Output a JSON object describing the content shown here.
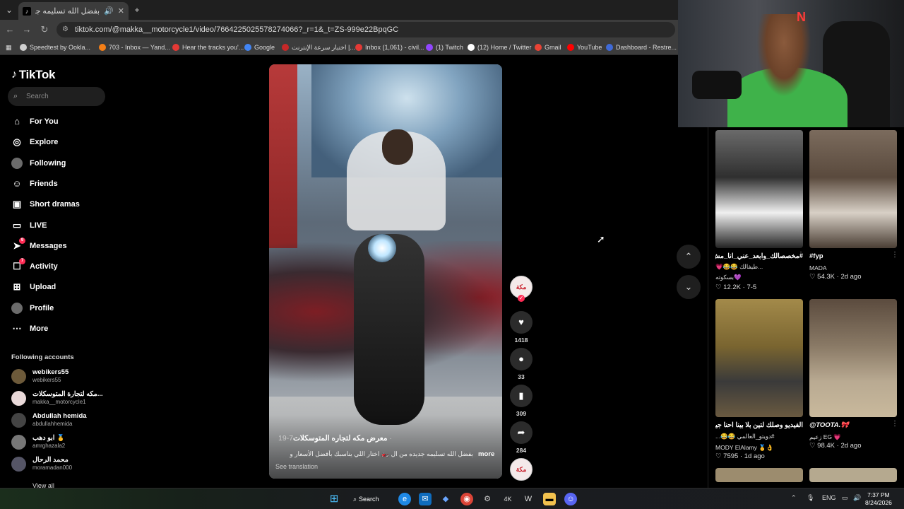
{
  "browser": {
    "tab_title": "بفضل الله تسليمه جديده من",
    "tab_close": "✕",
    "new_tab": "+",
    "url": "tiktok.com/@makka__motorcycle1/video/7664225025578274066?_r=1&_t=ZS-999e22BpqGC",
    "bookmarks": [
      {
        "label": "Speedtest by Ookla...",
        "color": "#cfcfcf"
      },
      {
        "label": "703 - Inbox — Yand...",
        "color": "#f57f17"
      },
      {
        "label": "Hear the tracks you'...",
        "color": "#e53935"
      },
      {
        "label": "Google",
        "color": "#4285f4"
      },
      {
        "label": "اختبار سرعة الإنترنت |...",
        "color": "#c62828"
      },
      {
        "label": "Inbox (1,061) - civil...",
        "color": "#e53935"
      },
      {
        "label": "(1) Twitch",
        "color": "#9146ff"
      },
      {
        "label": "(12) Home / Twitter",
        "color": "#ffffff"
      },
      {
        "label": "Gmail",
        "color": "#ea4335"
      },
      {
        "label": "YouTube",
        "color": "#ff0000"
      },
      {
        "label": "Dashboard - Restre...",
        "color": "#3f6ad8"
      }
    ]
  },
  "sidebar": {
    "logo": "TikTok",
    "search_placeholder": "Search",
    "nav": [
      {
        "label": "For You",
        "icon": "home-icon",
        "glyph": "⌂"
      },
      {
        "label": "Explore",
        "icon": "compass-icon",
        "glyph": "◎"
      },
      {
        "label": "Following",
        "icon": "following-avatar-icon",
        "glyph": "●"
      },
      {
        "label": "Friends",
        "icon": "friends-icon",
        "glyph": "☺"
      },
      {
        "label": "Short dramas",
        "icon": "film-icon",
        "glyph": "▣"
      },
      {
        "label": "LIVE",
        "icon": "live-tv-icon",
        "glyph": "▭"
      },
      {
        "label": "Messages",
        "icon": "send-icon",
        "glyph": "➤",
        "badge": "9"
      },
      {
        "label": "Activity",
        "icon": "activity-icon",
        "glyph": "☐",
        "badge": "7"
      },
      {
        "label": "Upload",
        "icon": "upload-plus-icon",
        "glyph": "⊞"
      },
      {
        "label": "Profile",
        "icon": "profile-avatar-icon",
        "glyph": "●"
      },
      {
        "label": "More",
        "icon": "more-dots-icon",
        "glyph": "⋯"
      }
    ],
    "following_title": "Following accounts",
    "accounts": [
      {
        "name": "webikers55",
        "handle": "webikers55",
        "color": "#6d5a3a"
      },
      {
        "name": "مكه لتجارة المتوسكلات...",
        "handle": "makka__motorcycle1",
        "color": "#e9d9d9"
      },
      {
        "name": "Abdullah hemida",
        "handle": "abdullahhemida",
        "color": "#444"
      },
      {
        "name": "ابو دهب 🥇",
        "handle": "amrghazala2",
        "color": "#777"
      },
      {
        "name": "محمد الرحال",
        "handle": "moramadan000",
        "color": "#556"
      }
    ],
    "view_all": "View all"
  },
  "video": {
    "author": "معرض مكه لتجاره المتوسكلات",
    "date": "7-19 ·",
    "description": "بفضل الله تسليمه جديده من ال 🏍️ اختار اللي يناسبك بأفضل الأسعار و",
    "more": "more",
    "see_translation": "See translation",
    "avatar_text": "مكة",
    "likes": "1418",
    "comments": "33",
    "saves": "309",
    "shares": "284"
  },
  "right_panel": {
    "items": [
      {
        "title": "#مخصصالك_وابعد_عني_انا_مش...",
        "sub": "💗😂😂 طيفالك...",
        "sub2": "بسكوته💜",
        "likes": "12.2K",
        "date": "7-5"
      },
      {
        "title": "#fyp",
        "sub": "MADA",
        "likes": "54.3K",
        "date": "2d ago"
      },
      {
        "title": "الفيديو وصلك لتين بلا بينا احنا جينا",
        "sub": "#دويتو_العالمي 😂😂...",
        "sub2": "MODY ElAlamy 🥇👌",
        "likes": "7595",
        "date": "1d ago"
      },
      {
        "title": "@TOOTA.🎀",
        "sub": "زعيم EG 💗",
        "likes": "98.4K",
        "date": "2d ago"
      }
    ]
  },
  "taskbar": {
    "search_label": "Search",
    "lang": "ENG",
    "time": "7:37 PM",
    "date": "8/24/2026"
  },
  "colors": {
    "accent": "#fe2c55",
    "bg": "#000000",
    "panel": "#1f1f1f"
  }
}
